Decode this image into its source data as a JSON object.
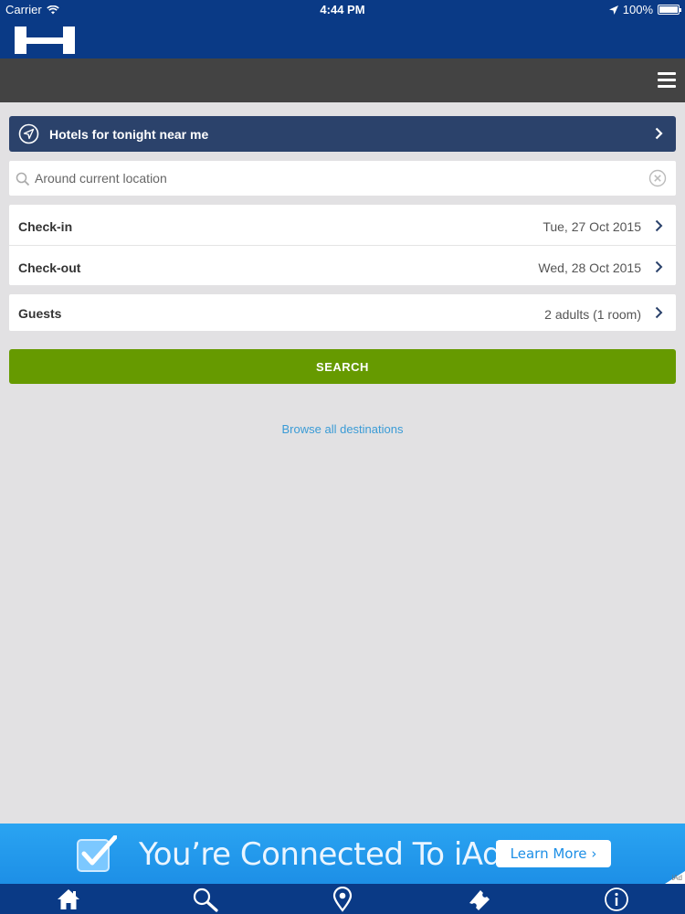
{
  "status_bar": {
    "carrier": "Carrier",
    "time": "4:44 PM",
    "battery": "100%"
  },
  "header": {
    "logo_icon": "hotel-h-logo",
    "menu_icon": "hamburger-menu-icon"
  },
  "tonight": {
    "label": "Hotels for tonight near me"
  },
  "search": {
    "placeholder": "Around current location"
  },
  "dates": {
    "checkin_label": "Check-in",
    "checkin_value": "Tue, 27 Oct 2015",
    "checkout_label": "Check-out",
    "checkout_value": "Wed, 28 Oct 2015"
  },
  "guests": {
    "label": "Guests",
    "value": "2 adults (1 room)"
  },
  "search_button": {
    "label": "SEARCH"
  },
  "browse": {
    "label": "Browse all destinations"
  },
  "ad": {
    "headline": "You’re Connected To iAd",
    "cta": "Learn More",
    "tag": "iAd"
  },
  "tabs": [
    "home-icon",
    "search-icon",
    "map-pin-icon",
    "ticket-icon",
    "info-icon"
  ],
  "colors": {
    "brand_blue": "#0a3a86",
    "toolbar_gray": "#434343",
    "tonight_bar": "#2b426b",
    "search_green": "#669a00",
    "link_blue": "#3a9bd6",
    "ad_blue": "#1d8fe6"
  }
}
